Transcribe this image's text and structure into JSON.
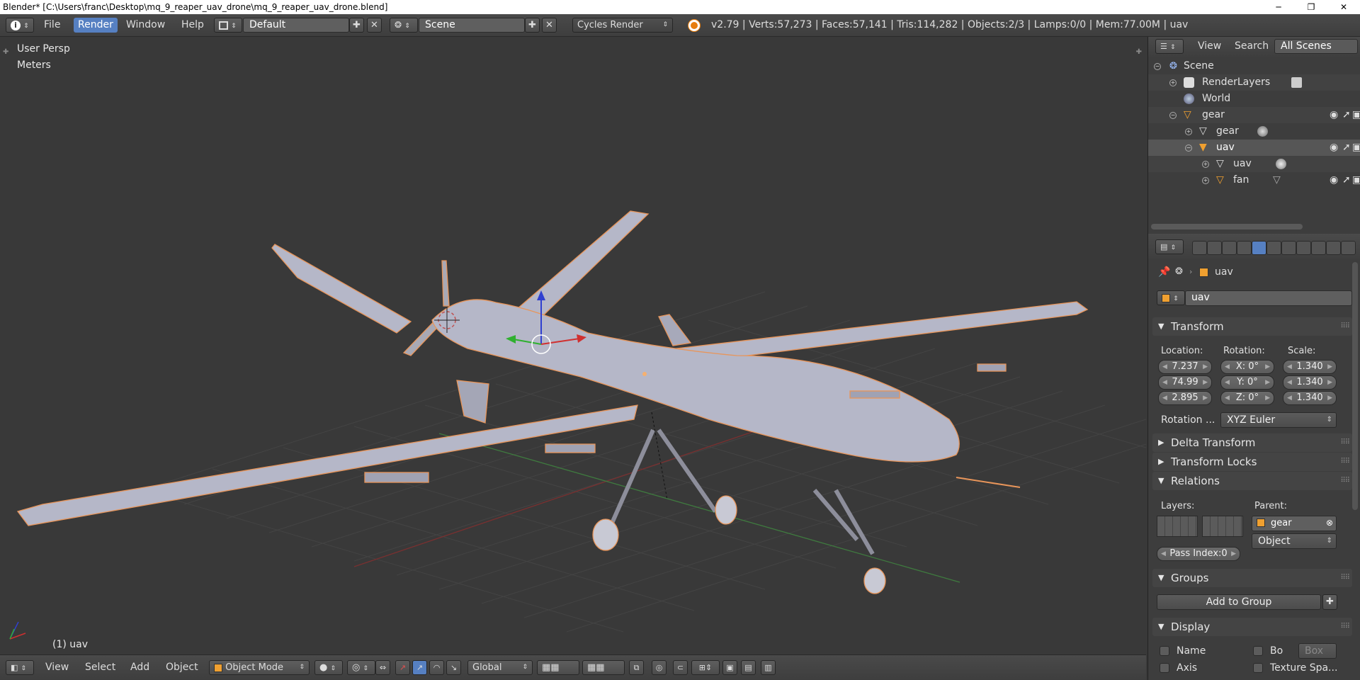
{
  "window": {
    "title": "Blender* [C:\\Users\\franc\\Desktop\\mq_9_reaper_uav_drone\\mq_9_reaper_uav_drone.blend]",
    "min": "─",
    "max": "❐",
    "close": "✕"
  },
  "infobar": {
    "menus": [
      "File",
      "Render",
      "Window",
      "Help"
    ],
    "active_menu": "Render",
    "layout": "Default",
    "scene": "Scene",
    "engine": "Cycles Render",
    "stats": "v2.79 | Verts:57,273 | Faces:57,141 | Tris:114,282 | Objects:2/3 | Lamps:0/0 | Mem:77.00M | uav"
  },
  "viewport": {
    "view_name": "User Persp",
    "units": "Meters",
    "active_object": "(1) uav"
  },
  "footer": {
    "menus": [
      "View",
      "Select",
      "Add",
      "Object"
    ],
    "mode": "Object Mode",
    "orientation": "Global"
  },
  "outliner": {
    "tabs": [
      "View",
      "Search",
      "All Scenes"
    ],
    "rows": [
      {
        "label": "Scene",
        "icon": "scene-icon"
      },
      {
        "label": "RenderLayers",
        "icon": "renderlayers-icon"
      },
      {
        "label": "World",
        "icon": "world-icon"
      },
      {
        "label": "gear",
        "icon": "empty-icon"
      },
      {
        "label": "gear",
        "icon": "mesh-icon"
      },
      {
        "label": "uav",
        "icon": "mesh-object-icon"
      },
      {
        "label": "uav",
        "icon": "mesh-icon"
      },
      {
        "label": "fan",
        "icon": "mesh-object-icon"
      }
    ]
  },
  "properties": {
    "breadcrumb": "uav",
    "object_name": "uav",
    "transform": {
      "title": "Transform",
      "location_label": "Location:",
      "rotation_label": "Rotation:",
      "scale_label": "Scale:",
      "location": [
        "7.237",
        "74.99",
        "2.895"
      ],
      "rotation": [
        "X:  0°",
        "Y:  0°",
        "Z:  0°"
      ],
      "scale": [
        "1.340",
        "1.340",
        "1.340"
      ],
      "rotation_mode_label": "Rotation ...",
      "rotation_mode": "XYZ Euler"
    },
    "delta_transform": "Delta Transform",
    "transform_locks": "Transform Locks",
    "relations": {
      "title": "Relations",
      "layers_label": "Layers:",
      "parent_label": "Parent:",
      "parent": "gear",
      "parent_type": "Object",
      "pass_index": "Pass Index:0"
    },
    "groups": {
      "title": "Groups",
      "add_button": "Add to Group"
    },
    "display": {
      "title": "Display",
      "name": "Name",
      "bounds": "Bo",
      "bounds_type": "Box",
      "axis": "Axis",
      "texture_space": "Texture Spa..."
    }
  }
}
